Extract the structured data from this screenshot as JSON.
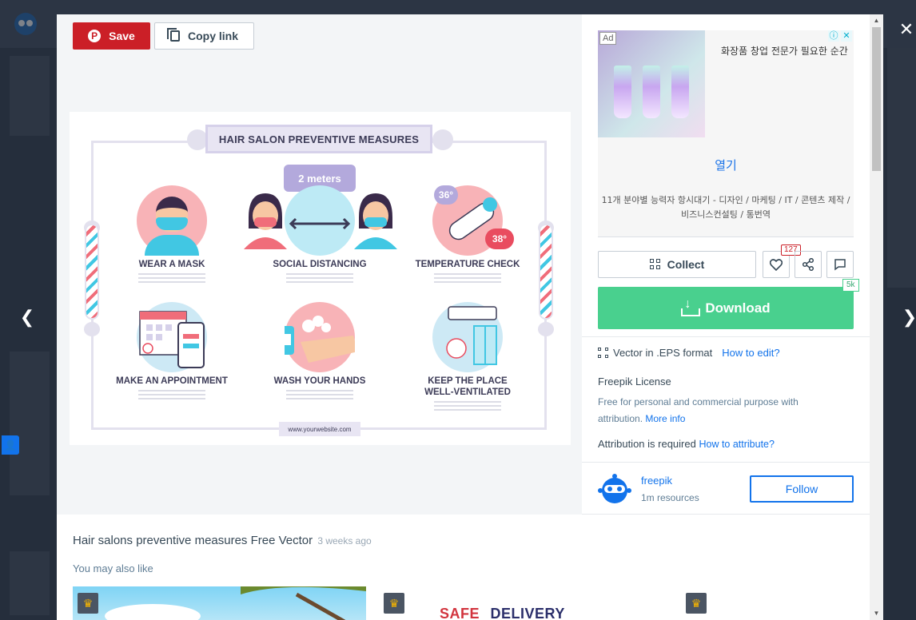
{
  "toolbar": {
    "save_label": "Save",
    "copy_label": "Copy link"
  },
  "infographic": {
    "title": "HAIR SALON PREVENTIVE MEASURES",
    "distance_label": "2 meters",
    "temp_low": "36°",
    "temp_high": "38°",
    "items": [
      {
        "label": "WEAR A MASK"
      },
      {
        "label": "SOCIAL DISTANCING"
      },
      {
        "label": "TEMPERATURE CHECK"
      },
      {
        "label": "MAKE AN APPOINTMENT"
      },
      {
        "label": "WASH YOUR HANDS"
      },
      {
        "label": "KEEP THE PLACE WELL-VENTILATED"
      }
    ],
    "footer": "www.yourwebsite.com"
  },
  "ad": {
    "tag": "Ad",
    "headline": "화장품 창업 전문가 필요한 순간",
    "open_label": "열기",
    "description": "11개 분야별 능력자 항시대기 - 디자인 / 마케팅 / IT / 콘텐츠 제작 / 비즈니스컨설팅 / 통번역"
  },
  "actions": {
    "collect_label": "Collect",
    "like_count": "127",
    "download_label": "Download",
    "download_count": "5k"
  },
  "details": {
    "format_text": "Vector in .EPS format",
    "how_to_edit": "How to edit?",
    "license_title": "Freepik License",
    "license_desc": "Free for personal and commercial purpose with attribution.",
    "more_info": "More info",
    "attribution_text": "Attribution is required",
    "how_to_attribute": "How to attribute?"
  },
  "author": {
    "name": "freepik",
    "resources": "1m resources",
    "follow_label": "Follow"
  },
  "resource": {
    "title": "Hair salons preventive measures Free Vector",
    "age": "3 weeks ago"
  },
  "related": {
    "heading": "You may also like",
    "thumb2_text_a": "SAFE",
    "thumb2_text_b": "DELIVERY"
  },
  "colors": {
    "save": "#cb1f27",
    "download": "#49d08e",
    "link": "#1273eb"
  },
  "icons": [
    "pinterest-icon",
    "copy-icon",
    "collect-icon",
    "heart-icon",
    "share-icon",
    "comment-icon",
    "download-icon",
    "vector-format-icon",
    "close-icon",
    "chevron-left-icon",
    "chevron-right-icon",
    "crown-icon"
  ]
}
